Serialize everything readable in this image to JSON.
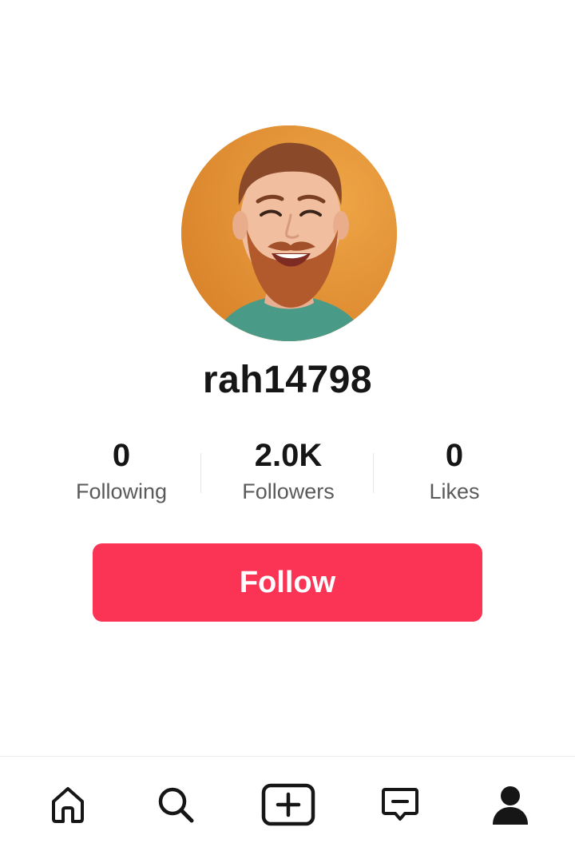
{
  "profile": {
    "username": "rah14798",
    "avatar_icon": "user-avatar-photo"
  },
  "stats": {
    "following": {
      "value": "0",
      "label": "Following"
    },
    "followers": {
      "value": "2.0K",
      "label": "Followers"
    },
    "likes": {
      "value": "0",
      "label": "Likes"
    }
  },
  "actions": {
    "follow_label": "Follow",
    "follow_color": "#fb3354"
  },
  "bottom_nav": {
    "items": [
      {
        "icon": "home-icon"
      },
      {
        "icon": "search-icon"
      },
      {
        "icon": "create-icon"
      },
      {
        "icon": "inbox-icon"
      },
      {
        "icon": "profile-icon"
      }
    ]
  }
}
